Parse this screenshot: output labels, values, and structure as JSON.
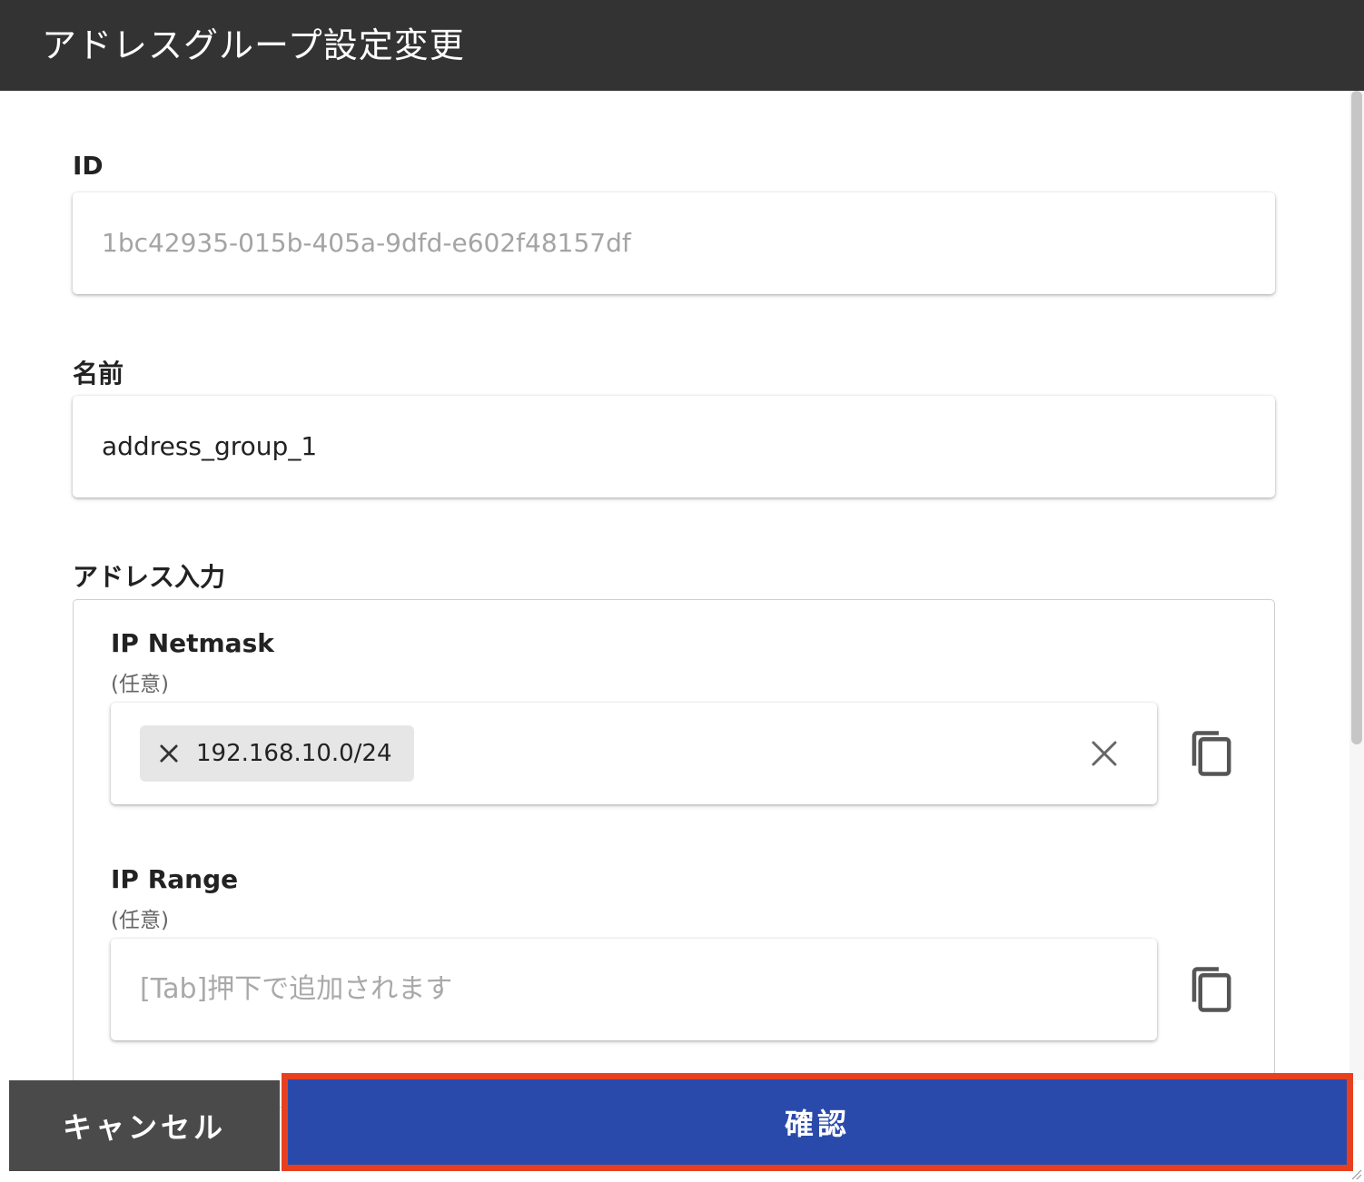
{
  "title": "アドレスグループ設定変更",
  "fields": {
    "id": {
      "label": "ID",
      "value": "1bc42935-015b-405a-9dfd-e602f48157df"
    },
    "name": {
      "label": "名前",
      "value": "address_group_1"
    }
  },
  "address_section": {
    "label": "アドレス入力",
    "netmask": {
      "label": "IP Netmask",
      "hint": "(任意)",
      "chips": [
        "192.168.10.0/24"
      ]
    },
    "range": {
      "label": "IP Range",
      "hint": "(任意)",
      "placeholder": "[Tab]押下で追加されます"
    }
  },
  "footer": {
    "cancel_label": "キャンセル",
    "confirm_label": "確認"
  },
  "colors": {
    "titlebar": "#333333",
    "confirm": "#2a4aab",
    "highlight": "#e8401f",
    "cancel": "#4a4a4a"
  }
}
